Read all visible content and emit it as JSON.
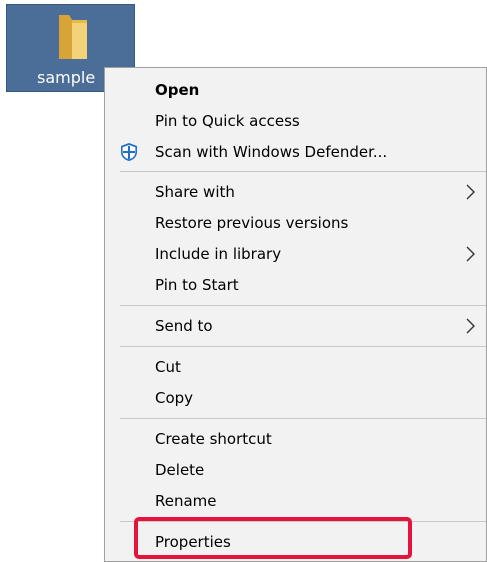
{
  "desktop": {
    "folder_label": "sample",
    "tile_color": "#4a6e97"
  },
  "context_menu": {
    "items": [
      {
        "label": "Open",
        "bold": true
      },
      {
        "label": "Pin to Quick access"
      },
      {
        "label": "Scan with Windows Defender...",
        "icon": "windows-defender-shield-icon"
      },
      {
        "label": "Share with",
        "submenu": true
      },
      {
        "label": "Restore previous versions"
      },
      {
        "label": "Include in library",
        "submenu": true
      },
      {
        "label": "Pin to Start"
      },
      {
        "label": "Send to",
        "submenu": true
      },
      {
        "label": "Cut"
      },
      {
        "label": "Copy"
      },
      {
        "label": "Create shortcut"
      },
      {
        "label": "Delete"
      },
      {
        "label": "Rename"
      },
      {
        "label": "Properties",
        "highlighted": true
      }
    ]
  },
  "colors": {
    "menu_background": "#f2f2f2",
    "highlight_outline": "#e4143c",
    "defender_blue": "#1e6fc7"
  }
}
